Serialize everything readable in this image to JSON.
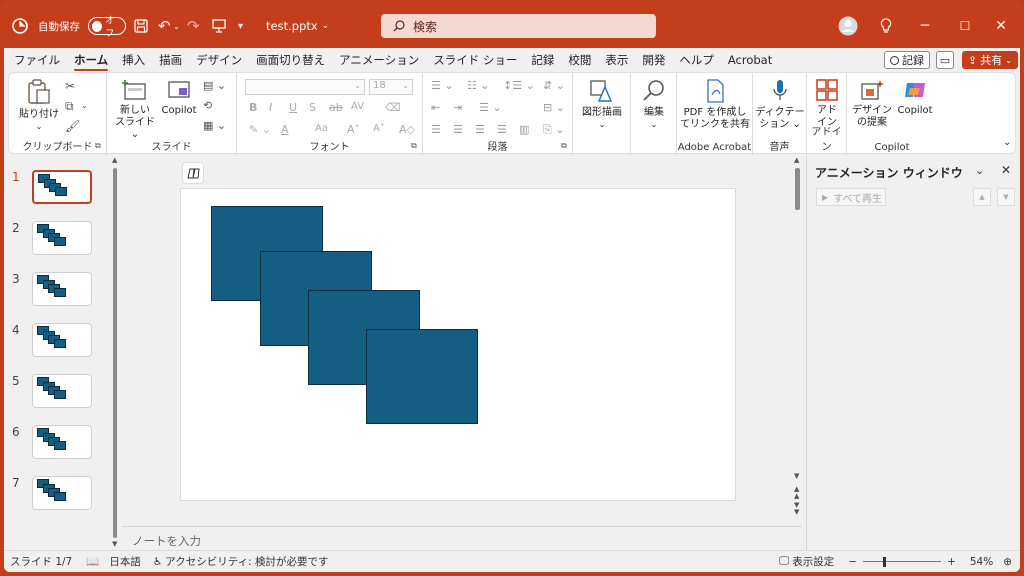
{
  "titlebar": {
    "autosave_label": "自動保存",
    "autosave_state": "オフ",
    "filename": "test.pptx",
    "search_placeholder": "検索"
  },
  "tabs": [
    "ファイル",
    "ホーム",
    "挿入",
    "描画",
    "デザイン",
    "画面切り替え",
    "アニメーション",
    "スライド ショー",
    "記録",
    "校閲",
    "表示",
    "開発",
    "ヘルプ",
    "Acrobat"
  ],
  "active_tab": "ホーム",
  "tab_buttons": {
    "record": "記録",
    "share": "共有"
  },
  "ribbon": {
    "clipboard": {
      "paste": "貼り付け",
      "label": "クリップボード"
    },
    "slides": {
      "new_slide_1": "新しい",
      "new_slide_2": "スライド",
      "copilot": "Copilot",
      "label": "スライド"
    },
    "font": {
      "size": "18",
      "label": "フォント",
      "buttons": [
        "B",
        "I",
        "U",
        "S",
        "ab",
        "AV",
        "Aa",
        "A",
        "A"
      ]
    },
    "paragraph": {
      "label": "段落"
    },
    "drawing": {
      "shapes": "図形描画"
    },
    "editing": {
      "label": "編集"
    },
    "acrobat": {
      "pdf_1": "PDF を作成し",
      "pdf_2": "てリンクを共有",
      "label": "Adobe Acrobat"
    },
    "voice": {
      "dictate_1": "ディクテー",
      "dictate_2": "ション",
      "label": "音声"
    },
    "addin": {
      "addin_1": "アド",
      "addin_2": "イン",
      "label": "アドイン"
    },
    "copilot": {
      "designer_1": "デザイン",
      "designer_2": "の提案",
      "copilot": "Copilot",
      "label": "Copilot"
    }
  },
  "thumbnails": [
    "1",
    "2",
    "3",
    "4",
    "5",
    "6",
    "7"
  ],
  "selected_slide": 1,
  "notes_placeholder": "ノートを入力",
  "animation_pane": {
    "title": "アニメーション ウィンドウ",
    "play_all": "すべて再生"
  },
  "status": {
    "slide": "スライド 1/7",
    "language": "日本語",
    "accessibility": "アクセシビリティ: 検討が必要です",
    "display_settings": "表示設定",
    "zoom": "54%"
  },
  "colors": {
    "accent": "#c43e1c",
    "shape_fill": "#135e82"
  }
}
